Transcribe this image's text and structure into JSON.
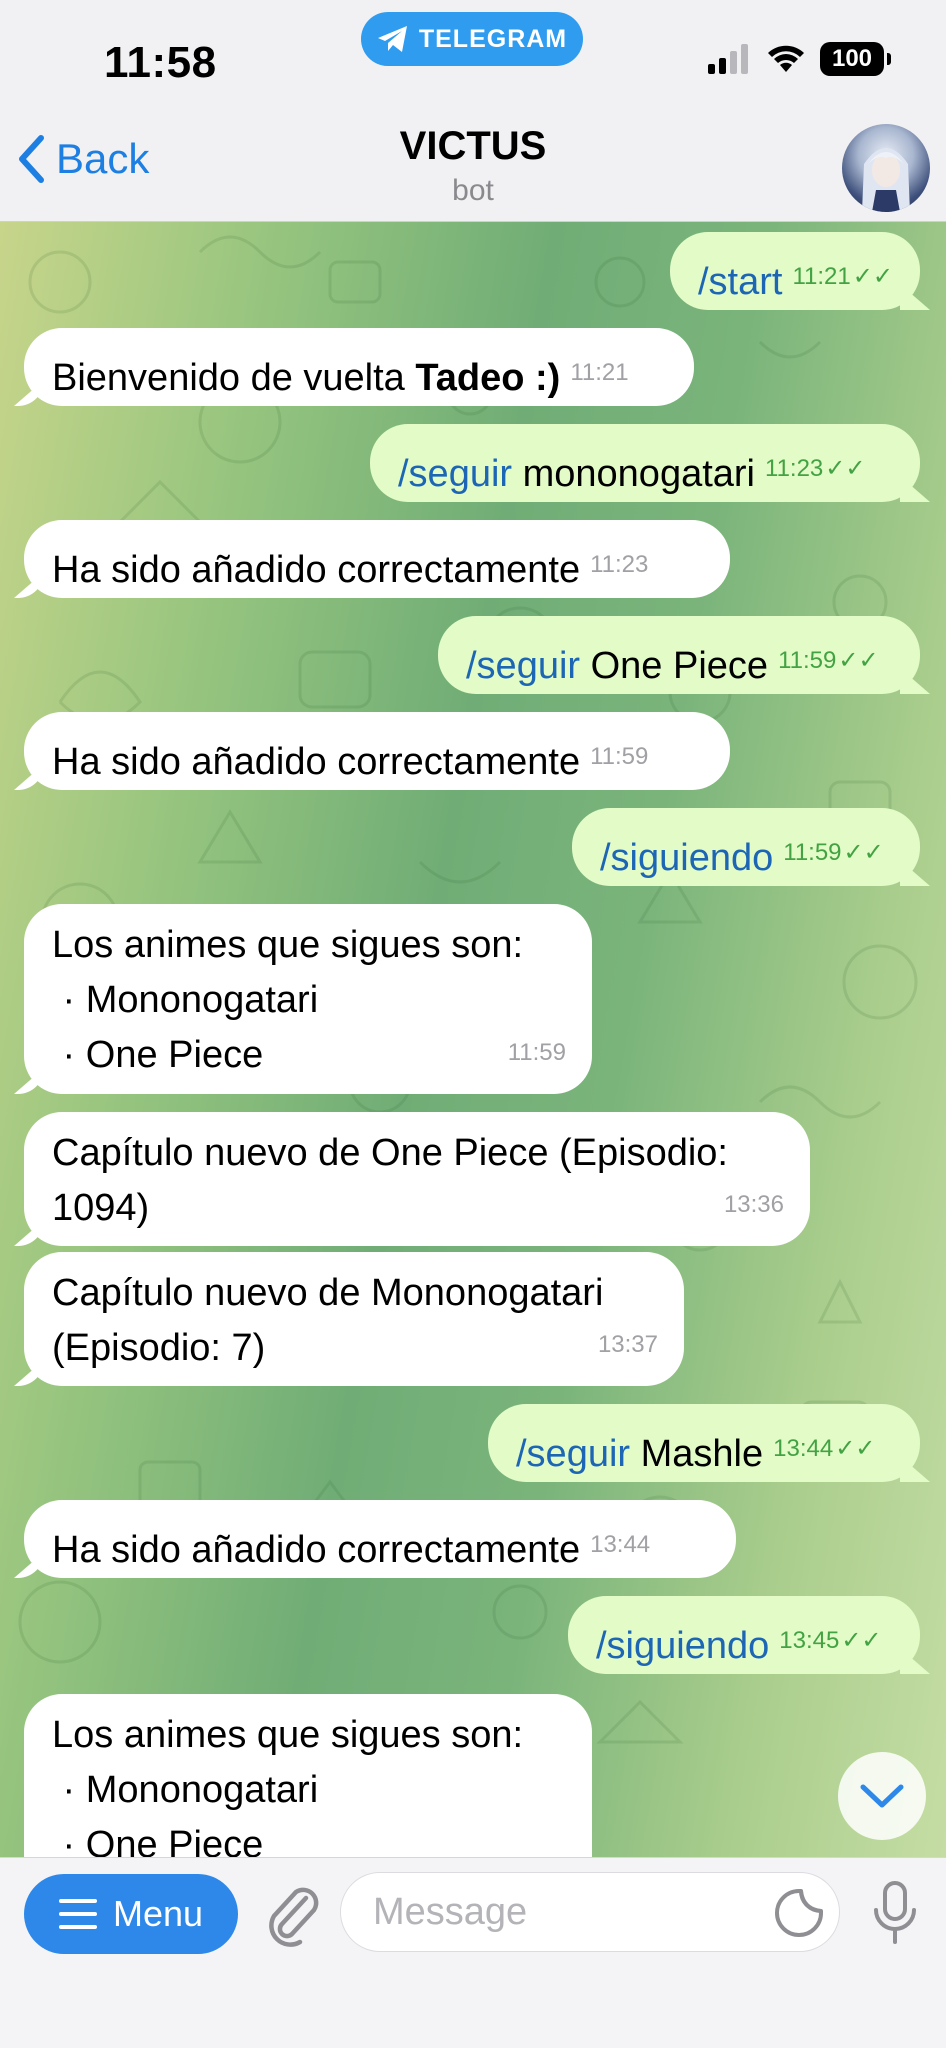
{
  "status_bar": {
    "time": "11:58",
    "app_pill": "TELEGRAM",
    "battery": "100"
  },
  "header": {
    "back_label": "Back",
    "title": "VICTUS",
    "subtitle": "bot"
  },
  "messages": [
    {
      "dir": "out",
      "cmd": "/start",
      "text": "",
      "time": "11:21",
      "ticks": "✓✓"
    },
    {
      "dir": "in",
      "text": "Bienvenido de vuelta ",
      "bold": "Tadeo :)",
      "time": "11:21"
    },
    {
      "dir": "out",
      "cmd": "/seguir",
      "text": " mononogatari",
      "time": "11:23",
      "ticks": "✓✓"
    },
    {
      "dir": "in",
      "text": "Ha sido añadido correctamente",
      "time": "11:23"
    },
    {
      "dir": "out",
      "cmd": "/seguir",
      "text": " One Piece",
      "time": "11:59",
      "ticks": "✓✓"
    },
    {
      "dir": "in",
      "text": "Ha sido añadido correctamente",
      "time": "11:59"
    },
    {
      "dir": "out",
      "cmd": "/siguiendo",
      "text": "",
      "time": "11:59",
      "ticks": "✓✓"
    },
    {
      "dir": "in",
      "lines": [
        "Los animes que sigues son:",
        " · Mononogatari",
        " · One Piece"
      ],
      "time": "11:59"
    },
    {
      "dir": "in",
      "lines": [
        "Capítulo nuevo de One Piece (Episodio:",
        "1094)"
      ],
      "time": "13:36"
    },
    {
      "dir": "in",
      "lines": [
        "Capítulo nuevo de Mononogatari",
        "(Episodio: 7)"
      ],
      "time": "13:37"
    },
    {
      "dir": "out",
      "cmd": "/seguir",
      "text": " Mashle",
      "time": "13:44",
      "ticks": "✓✓"
    },
    {
      "dir": "in",
      "text": "Ha sido añadido correctamente",
      "time": "13:44"
    },
    {
      "dir": "out",
      "cmd": "/siguiendo",
      "text": "",
      "time": "13:45",
      "ticks": "✓✓"
    },
    {
      "dir": "in",
      "lines": [
        "Los animes que sigues son:",
        " · Mononogatari",
        " · One Piece"
      ],
      "time": ""
    }
  ],
  "input": {
    "menu_label": "Menu",
    "placeholder": "Message"
  },
  "colors": {
    "accent": "#2d88ea",
    "outgoing_bubble": "#e2fbc7",
    "incoming_bubble": "#ffffff",
    "command_text": "#1c66b5"
  }
}
